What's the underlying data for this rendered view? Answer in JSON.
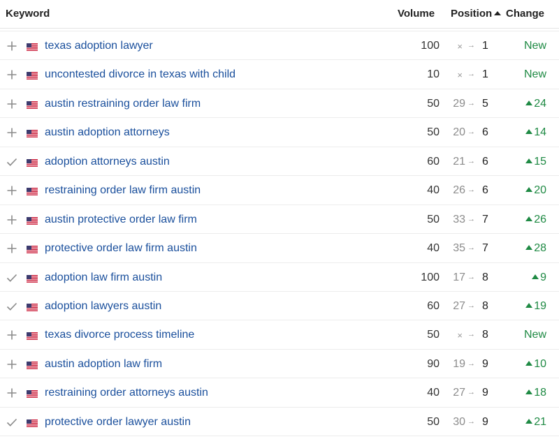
{
  "header": {
    "keyword": "Keyword",
    "volume": "Volume",
    "position": "Position",
    "change": "Change"
  },
  "rows": [
    {
      "action": "plus",
      "keyword": "texas adoption lawyer",
      "volume": "100",
      "from": "×",
      "to": "1",
      "change": "New",
      "up": false
    },
    {
      "action": "plus",
      "keyword": "uncontested divorce in texas with child",
      "volume": "10",
      "from": "×",
      "to": "1",
      "change": "New",
      "up": false
    },
    {
      "action": "plus",
      "keyword": "austin restraining order law firm",
      "volume": "50",
      "from": "29",
      "to": "5",
      "change": "24",
      "up": true
    },
    {
      "action": "plus",
      "keyword": "austin adoption attorneys",
      "volume": "50",
      "from": "20",
      "to": "6",
      "change": "14",
      "up": true
    },
    {
      "action": "check",
      "keyword": "adoption attorneys austin",
      "volume": "60",
      "from": "21",
      "to": "6",
      "change": "15",
      "up": true
    },
    {
      "action": "plus",
      "keyword": "restraining order law firm austin",
      "volume": "40",
      "from": "26",
      "to": "6",
      "change": "20",
      "up": true
    },
    {
      "action": "plus",
      "keyword": "austin protective order law firm",
      "volume": "50",
      "from": "33",
      "to": "7",
      "change": "26",
      "up": true
    },
    {
      "action": "plus",
      "keyword": "protective order law firm austin",
      "volume": "40",
      "from": "35",
      "to": "7",
      "change": "28",
      "up": true
    },
    {
      "action": "check",
      "keyword": "adoption law firm austin",
      "volume": "100",
      "from": "17",
      "to": "8",
      "change": "9",
      "up": true
    },
    {
      "action": "check",
      "keyword": "adoption lawyers austin",
      "volume": "60",
      "from": "27",
      "to": "8",
      "change": "19",
      "up": true
    },
    {
      "action": "plus",
      "keyword": "texas divorce process timeline",
      "volume": "50",
      "from": "×",
      "to": "8",
      "change": "New",
      "up": false
    },
    {
      "action": "plus",
      "keyword": "austin adoption law firm",
      "volume": "90",
      "from": "19",
      "to": "9",
      "change": "10",
      "up": true
    },
    {
      "action": "plus",
      "keyword": "restraining order attorneys austin",
      "volume": "40",
      "from": "27",
      "to": "9",
      "change": "18",
      "up": true
    },
    {
      "action": "check",
      "keyword": "protective order lawyer austin",
      "volume": "50",
      "from": "30",
      "to": "9",
      "change": "21",
      "up": true
    }
  ],
  "arrow_glyph": "→",
  "colors": {
    "link": "#1a4f9c",
    "positive": "#1f8a44",
    "muted": "#8c8c8c"
  }
}
